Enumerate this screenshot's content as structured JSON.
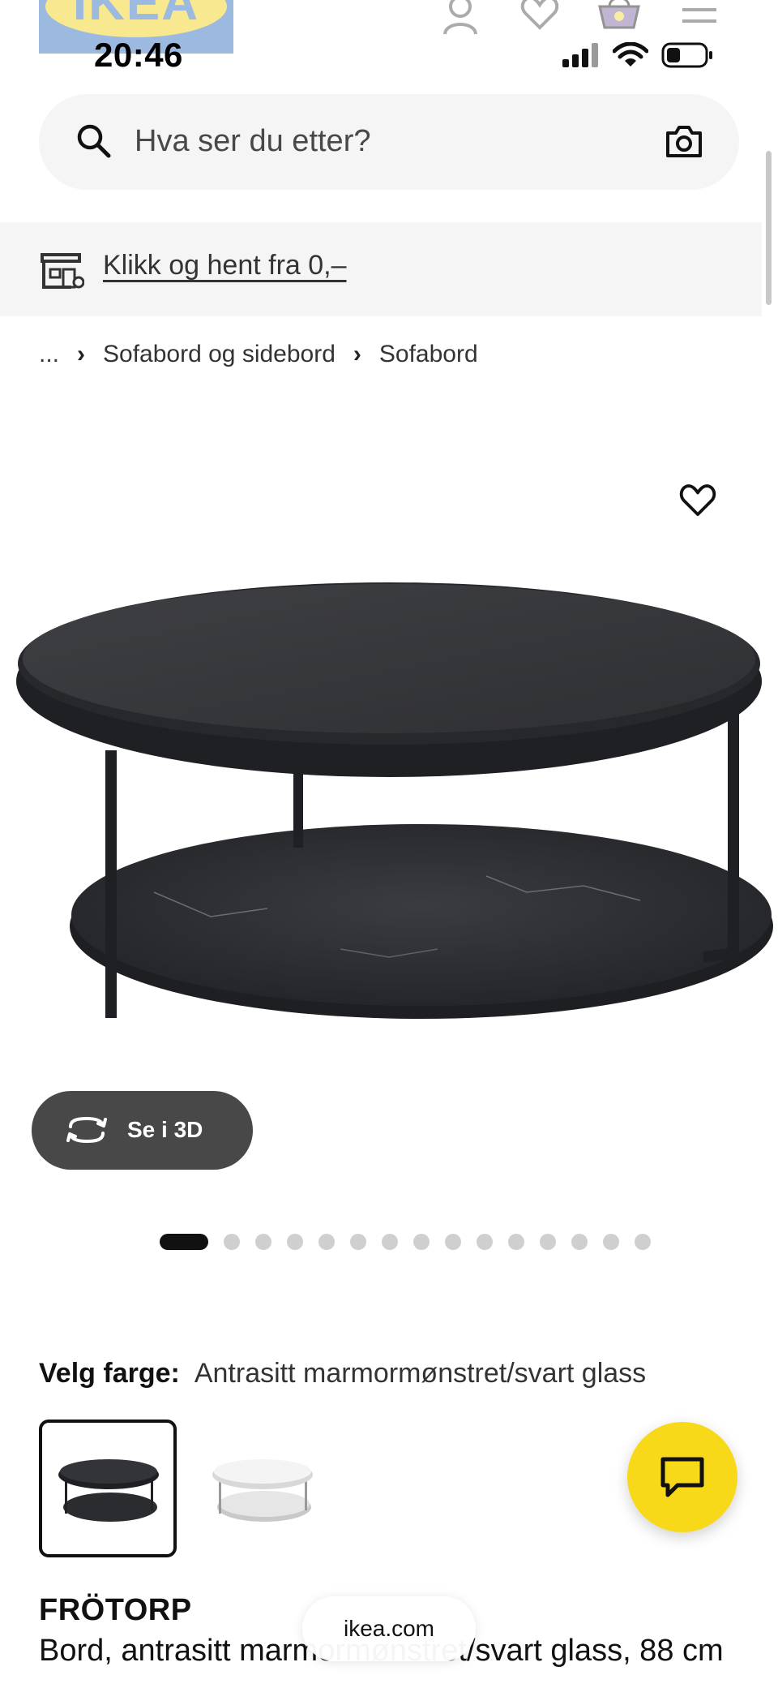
{
  "header": {
    "logo_text": "IKEA",
    "status_time": "20:46",
    "icons": [
      "user-icon",
      "heart-icon",
      "basket-icon",
      "hamburger-menu-icon"
    ],
    "status_icons": [
      "cellular-signal-icon",
      "wifi-icon",
      "battery-icon"
    ]
  },
  "search": {
    "placeholder": "Hva ser du etter?",
    "icons": [
      "search-icon",
      "camera-icon"
    ]
  },
  "pickup": {
    "label": "Klikk og hent fra 0,–",
    "icon": "store-pickup-icon"
  },
  "breadcrumb": {
    "items": [
      "...",
      "Sofabord og sidebord",
      "Sofabord"
    ]
  },
  "gallery": {
    "see_3d_label": "Se i 3D",
    "image_count": 15,
    "active_index": 0
  },
  "color_chooser": {
    "label": "Velg farge:",
    "value": "Antrasitt marmormønstret/svart glass",
    "options": [
      "dark-table-thumbnail",
      "white-table-thumbnail"
    ],
    "selected_index": 0
  },
  "product": {
    "name": "FRÖTORP",
    "description": "Bord, antrasitt marmormønstret/svart glass, 88 cm"
  },
  "browser": {
    "url": "ikea.com"
  },
  "colors": {
    "brand_yellow": "#f8d91a",
    "brand_blue": "#4d83c6",
    "dark_button": "#484848",
    "search_bg": "#f5f5f5"
  }
}
